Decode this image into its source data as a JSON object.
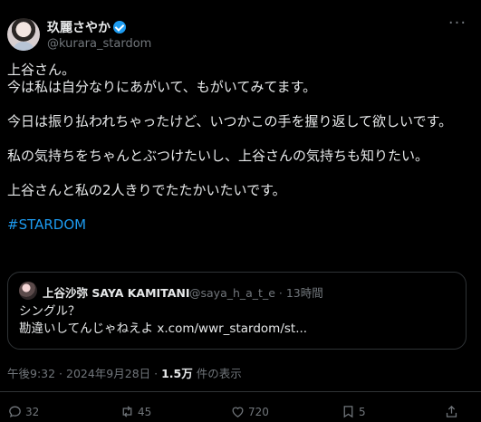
{
  "author": {
    "name": "玖麗さやか",
    "handle": "@kurara_stardom"
  },
  "tweet": {
    "lines": [
      "上谷さん。",
      "今は私は自分なりにあがいて、もがいてみてます。",
      "今日は振り払われちゃったけど、いつかこの手を握り返して欲しいです。",
      "私の気持ちをちゃんとぶつけたいし、上谷さんの気持ちも知りたい。",
      "上谷さんと私の2人きりでたたかいたいです。"
    ],
    "hashtag": "#STARDOM"
  },
  "quote": {
    "name": "上谷沙弥 SAYA KAMITANI",
    "meta": "@saya_h_a_t_e · 13時間",
    "line1": "シングル？",
    "line2": "勘違いしてんじゃねえよ x.com/wwr_stardom/st..."
  },
  "timestamp": {
    "time": "午後9:32 · 2024年9月28日 · ",
    "views": "1.5万",
    "views_label": " 件の表示"
  },
  "actions": {
    "replies": "32",
    "reposts": "45",
    "likes": "720",
    "bookmarks": "5"
  },
  "icons": [
    "verified-badge-icon",
    "more-icon",
    "reply-icon",
    "repost-icon",
    "like-icon",
    "bookmark-icon",
    "share-icon"
  ],
  "colors": {
    "background": "#000000",
    "text": "#e7e9ea",
    "secondary": "#71767b",
    "accent": "#1d9bf0",
    "border": "#2f3336"
  }
}
